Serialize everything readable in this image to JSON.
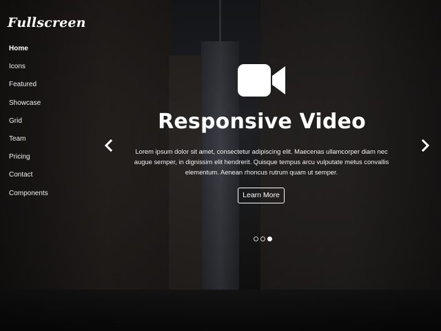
{
  "brand": {
    "logo_text": "Fullscreen"
  },
  "nav": {
    "items": [
      {
        "label": "Home",
        "active": true
      },
      {
        "label": "Icons",
        "active": false
      },
      {
        "label": "Featured",
        "active": false
      },
      {
        "label": "Showcase",
        "active": false
      },
      {
        "label": "Grid",
        "active": false
      },
      {
        "label": "Team",
        "active": false
      },
      {
        "label": "Pricing",
        "active": false
      },
      {
        "label": "Contact",
        "active": false
      },
      {
        "label": "Components",
        "active": false
      }
    ]
  },
  "hero": {
    "icon": "video-camera-icon",
    "title": "Responsive Video",
    "text": "Lorem ipsum dolor sit amet, consectetur adipiscing elit. Maecenas ullamcorper diam nec augue semper, in dignissim elit hendrerit. Quisque tempus arcu vulputate metus convallis elementum. Aenean rhoncus rutrum quam ut semper.",
    "cta_label": "Learn More"
  },
  "carousel": {
    "prev_icon": "chevron-left-icon",
    "next_icon": "chevron-right-icon",
    "slide_count": 3,
    "active_index": 2
  },
  "colors": {
    "text": "#ffffff",
    "background": "#1a1b1e"
  }
}
